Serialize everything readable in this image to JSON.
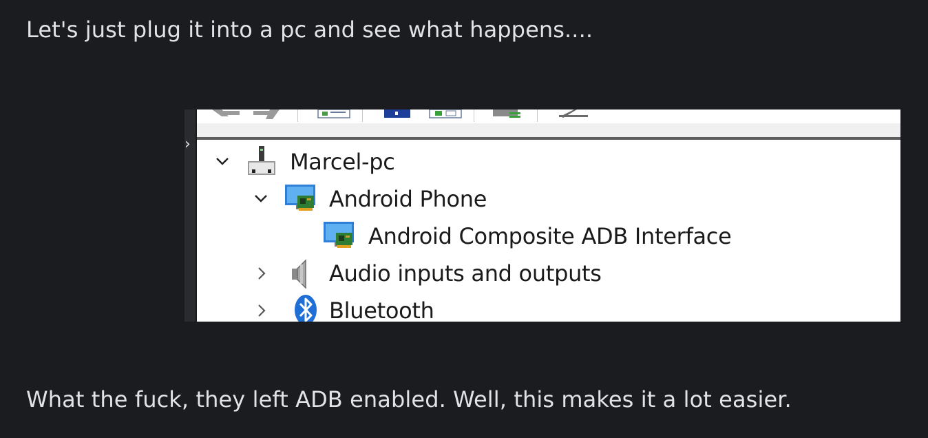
{
  "paragraphs": {
    "intro": "Let's just plug it into a pc and see what happens....",
    "outro": "What the fuck, they left ADB enabled. Well, this makes it a lot easier."
  },
  "device_manager": {
    "root": "Marcel-pc",
    "items": [
      {
        "label": "Android Phone",
        "expanded": true,
        "icon": "monitor-board-icon"
      },
      {
        "label": "Android Composite ADB Interface",
        "child": true,
        "icon": "monitor-board-icon"
      },
      {
        "label": "Audio inputs and outputs",
        "expanded": false,
        "icon": "speaker-icon"
      },
      {
        "label": "Bluetooth",
        "expanded": false,
        "icon": "bluetooth-icon"
      }
    ]
  }
}
